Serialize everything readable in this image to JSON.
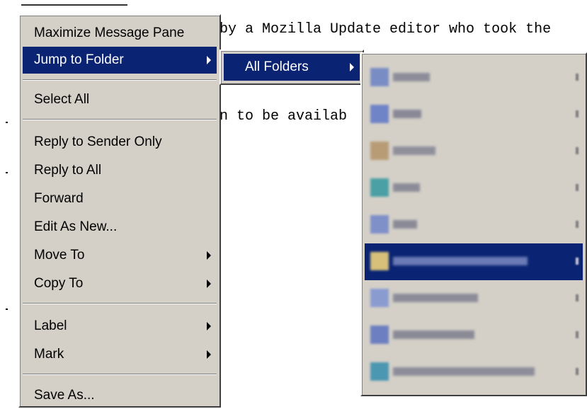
{
  "background": {
    "top_line": "by a Mozilla Update editor who took the",
    "second_line": "n to be availab"
  },
  "context_menu": {
    "items": [
      {
        "label": "Maximize Message Pane"
      },
      {
        "label": "Jump to Folder",
        "submenu": true,
        "highlighted": true
      },
      {
        "label": "Select All"
      },
      {
        "label": "Reply to Sender Only"
      },
      {
        "label": "Reply to All"
      },
      {
        "label": "Forward"
      },
      {
        "label": "Edit As New..."
      },
      {
        "label": "Move To",
        "submenu": true
      },
      {
        "label": "Copy To",
        "submenu": true
      },
      {
        "label": "Label",
        "submenu": true
      },
      {
        "label": "Mark",
        "submenu": true
      },
      {
        "label": "Save As..."
      }
    ]
  },
  "jump_submenu": {
    "items": [
      {
        "label": "All Folders",
        "submenu": true,
        "highlighted": true
      }
    ]
  },
  "folders_submenu": {
    "note": "folder names are pixelated/obscured in the screenshot",
    "items": [
      {
        "icon_color": "#7a8cc4",
        "highlighted": false
      },
      {
        "icon_color": "#6f83c7",
        "highlighted": false
      },
      {
        "icon_color": "#b89c76",
        "highlighted": false
      },
      {
        "icon_color": "#4aa0a4",
        "highlighted": false
      },
      {
        "icon_color": "#7f8fc8",
        "highlighted": false
      },
      {
        "icon_color": "#d6c07a",
        "highlighted": true
      },
      {
        "icon_color": "#8a9bd0",
        "highlighted": false
      },
      {
        "icon_color": "#6d7fc0",
        "highlighted": false
      },
      {
        "icon_color": "#4b96b0",
        "highlighted": false
      }
    ]
  },
  "colors": {
    "menu_bg": "#d4d0c8",
    "highlight": "#0a2473",
    "highlight_text": "#ffffff"
  }
}
